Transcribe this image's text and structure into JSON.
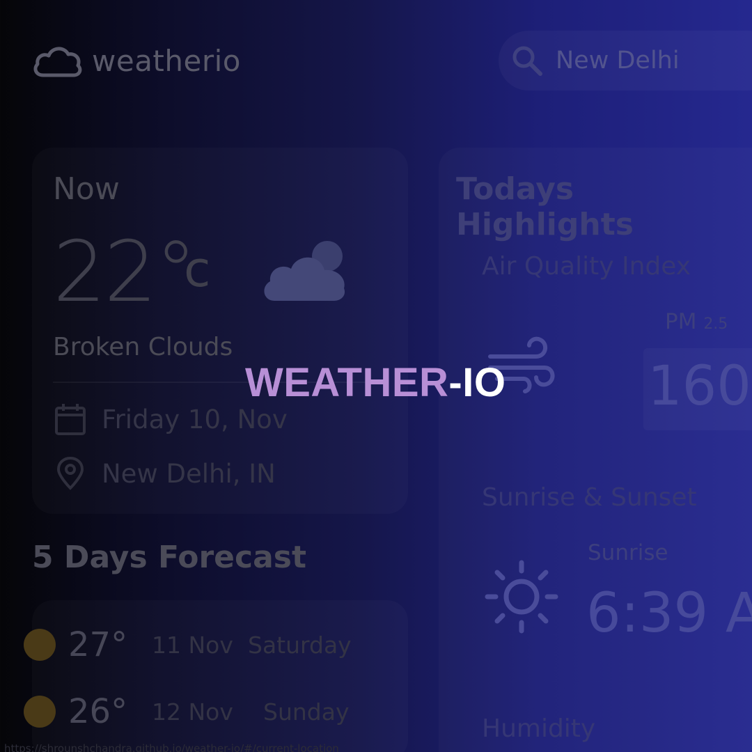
{
  "app": {
    "logo_text": "weatherio"
  },
  "search": {
    "value": "New Delhi"
  },
  "now": {
    "label": "Now",
    "temp": "22°",
    "unit": "c",
    "description": "Broken Clouds",
    "date": "Friday 10, Nov",
    "location": "New Delhi, IN"
  },
  "forecast": {
    "title": "5 Days Forecast",
    "rows": [
      {
        "temp": "27°",
        "date": "11 Nov",
        "day": "Saturday"
      },
      {
        "temp": "26°",
        "date": "12 Nov",
        "day": "Sunday"
      }
    ]
  },
  "highlights": {
    "title": "Todays Highlights",
    "air_quality": {
      "title": "Air Quality Index",
      "pm_label": "PM",
      "pm_sub": "2.5",
      "pm_value": "160"
    },
    "sun": {
      "title": "Sunrise & Sunset",
      "sunrise_label": "Sunrise",
      "sunrise_value": "6:39 A"
    },
    "humidity_title": "Humidity"
  },
  "status_url": "https://shrounshchandra.github.io/weather-io/#/current-location",
  "headline": {
    "part1": "WEATHER",
    "part2": "-IO"
  },
  "colors": {
    "headline_accent": "#b88fd6",
    "background_end": "#25288f"
  }
}
